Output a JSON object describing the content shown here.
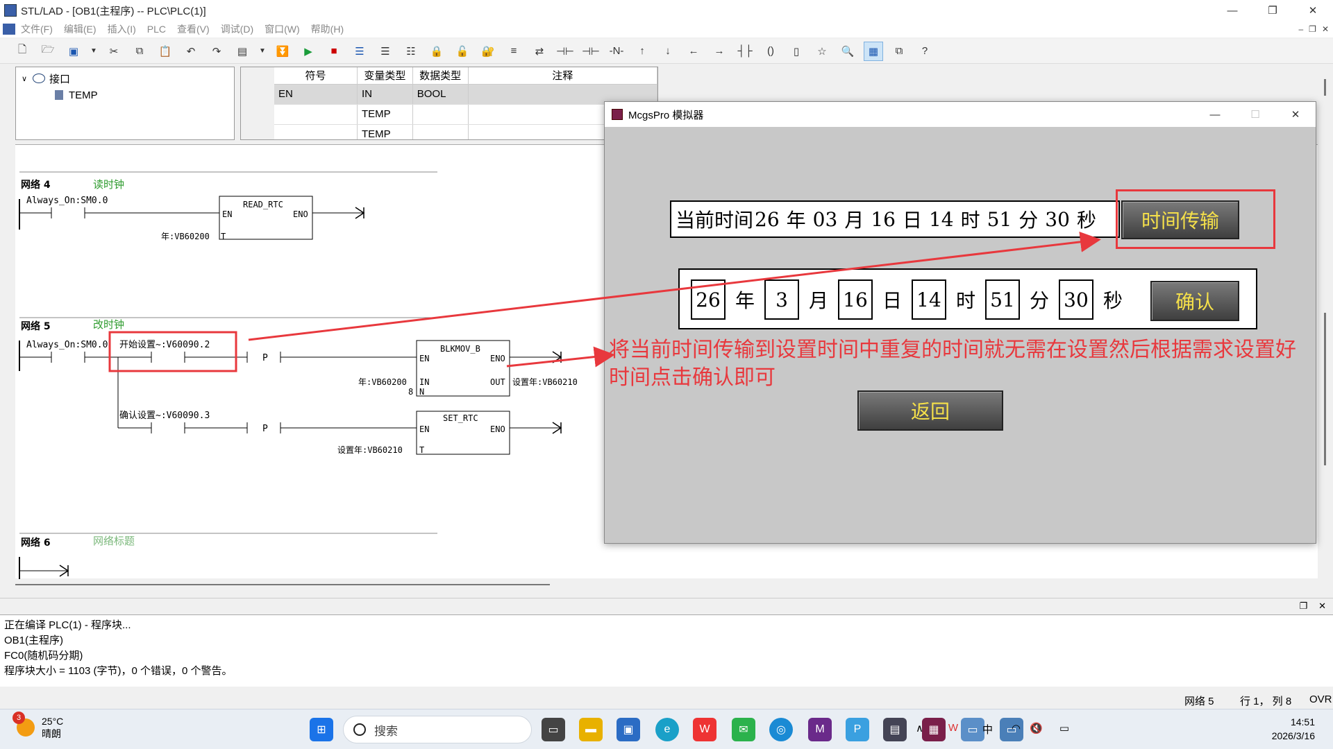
{
  "window": {
    "title": "STL/LAD - [OB1(主程序) -- PLC\\PLC(1)]",
    "min": "—",
    "max": "❐",
    "close": "✕"
  },
  "menu": {
    "items": [
      "文件(F)",
      "编辑(E)",
      "插入(I)",
      "PLC",
      "查看(V)",
      "调试(D)",
      "窗口(W)",
      "帮助(H)"
    ],
    "mdi_min": "–",
    "mdi_restore": "❐",
    "mdi_close": "✕"
  },
  "toolbar": {
    "icons": [
      "new-icon",
      "open-icon",
      "save-icon",
      "dropdown-icon",
      "cut-icon",
      "copy-icon",
      "paste-icon",
      "undo-icon",
      "redo-icon",
      "compile-icon",
      "dropdown-icon",
      "download-icon",
      "run-icon",
      "stop-icon",
      "network-insert-icon",
      "network-delete-icon",
      "network-icon",
      "lock-icon",
      "unlock-icon",
      "lock2-icon",
      "list-icon",
      "compare-icon",
      "contact-icon",
      "contact2-icon",
      "contact3-icon",
      "not-contact-icon",
      "rise-icon",
      "fall-icon",
      "left-icon",
      "right-icon",
      "parallel-icon",
      "coil-icon",
      "box-icon",
      "star-icon",
      "zoom-icon",
      "grid-icon",
      "window-icon",
      "help-icon"
    ]
  },
  "tree": {
    "root": "接口",
    "child": "TEMP"
  },
  "var_table": {
    "headers": [
      "符号",
      "变量类型",
      "数据类型",
      "注释"
    ],
    "rows": [
      [
        "",
        "EN",
        "IN",
        "BOOL",
        ""
      ],
      [
        "",
        "",
        "TEMP",
        "",
        ""
      ],
      [
        "",
        "",
        "TEMP",
        "",
        ""
      ]
    ]
  },
  "networks": [
    {
      "label": "网络 4",
      "comment": "读时钟",
      "contact": "Always_On:SM0.0",
      "box": "READ_RTC",
      "en": "EN",
      "eno": "ENO",
      "param_t": "年:VB60200",
      "pin_t": "T"
    },
    {
      "label": "网络 5",
      "comment": "改时钟",
      "contact1": "Always_On:SM0.0",
      "contact2": "开始设置~:V60090.2",
      "contact3": "确认设置~:V60090.3",
      "p_label": "P",
      "box1": "BLKMOV_B",
      "box1_in": "年:VB60200",
      "box1_n": "8",
      "box1_out": "设置年:VB60210",
      "pin_in": "IN",
      "pin_n": "N",
      "pin_out": "OUT",
      "box2": "SET_RTC",
      "box2_t": "设置年:VB60210",
      "en": "EN",
      "eno": "ENO",
      "pin_t": "T"
    },
    {
      "label": "网络 6",
      "comment": "网络标题"
    }
  ],
  "output": {
    "lines": [
      "正在编译 PLC(1) - 程序块...",
      "OB1(主程序)",
      "FC0(随机码分期)",
      "程序块大小 = 1103 (字节)，0 个错误，0 个警告。"
    ]
  },
  "status": {
    "network": "网络 5",
    "position": "行 1，  列 8",
    "mode": "OVR"
  },
  "simulator": {
    "title": "McgsPro 模拟器",
    "current_label": "当前时间",
    "current": {
      "year": "26",
      "month": "03",
      "day": "16",
      "hour": "14",
      "minute": "51",
      "second": "30"
    },
    "units": {
      "year": "年",
      "month": "月",
      "day": "日",
      "hour": "时",
      "minute": "分",
      "second": "秒"
    },
    "transfer_button": "时间传输",
    "set": {
      "year": "26",
      "month": "3",
      "day": "16",
      "hour": "14",
      "minute": "51",
      "second": "30"
    },
    "confirm_button": "确认",
    "note": "将当前时间传输到设置时间中重复的时间就无需在设置然后根据需求设置好时间点击确认即可",
    "back_button": "返回"
  },
  "taskbar": {
    "weather_temp": "25°C",
    "weather_desc": "晴朗",
    "weather_badge": "3",
    "search_placeholder": "搜索",
    "ime": "中",
    "time": "14:51",
    "date": "2026/3/16"
  },
  "colors": {
    "annotation_red": "#e8383d",
    "button_text": "#f5e04a",
    "comment_green": "#2e9b2e"
  }
}
